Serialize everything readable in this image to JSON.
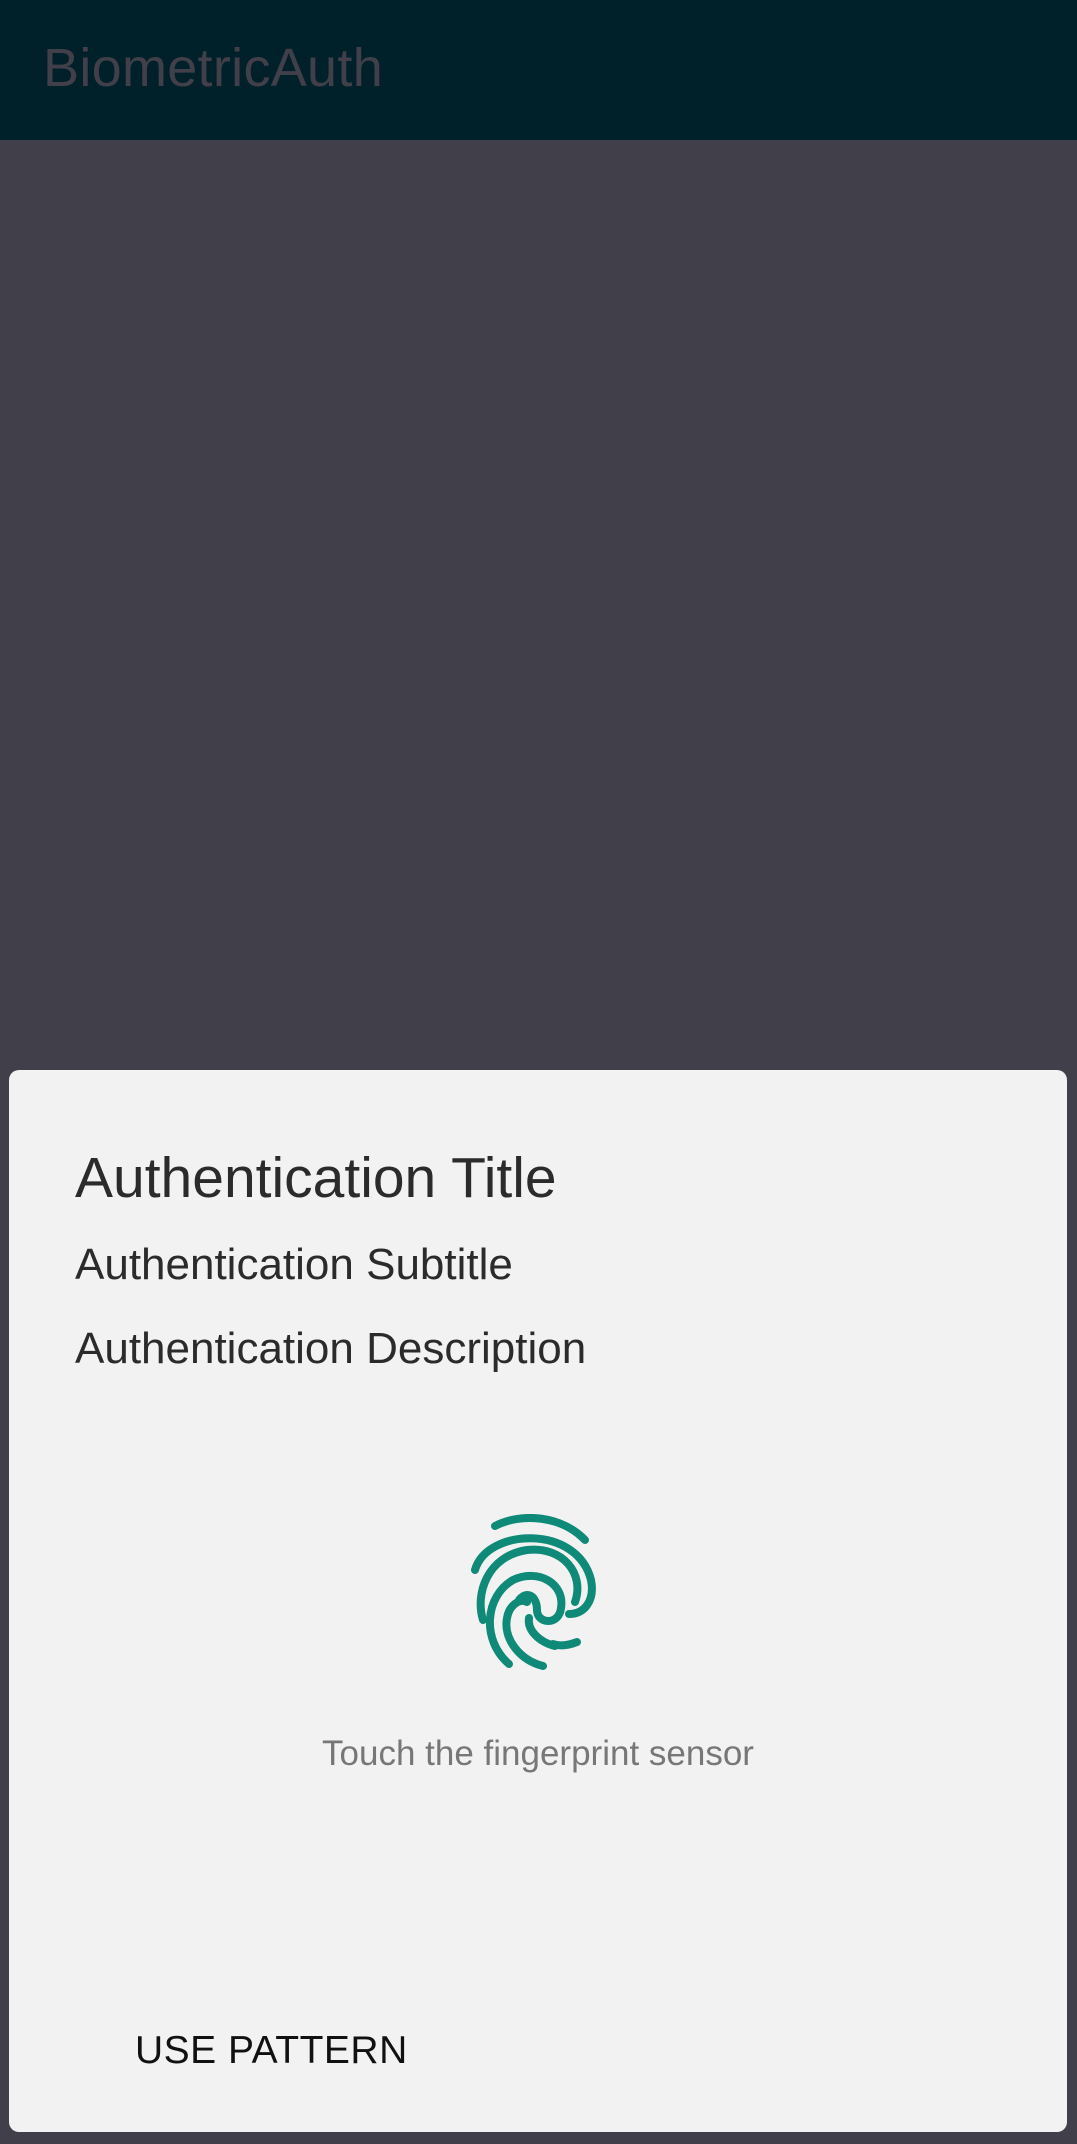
{
  "app_bar": {
    "title": "BiometricAuth"
  },
  "dialog": {
    "title": "Authentication Title",
    "subtitle": "Authentication Subtitle",
    "description": "Authentication Description",
    "icon": "fingerprint-icon",
    "hint": "Touch the fingerprint sensor",
    "negative_button_label": "USE PATTERN"
  },
  "colors": {
    "app_bar_background": "#00212a",
    "scrim": "#413f49",
    "sheet_background": "#f2f2f2",
    "fingerprint_accent": "#0f8a78"
  }
}
